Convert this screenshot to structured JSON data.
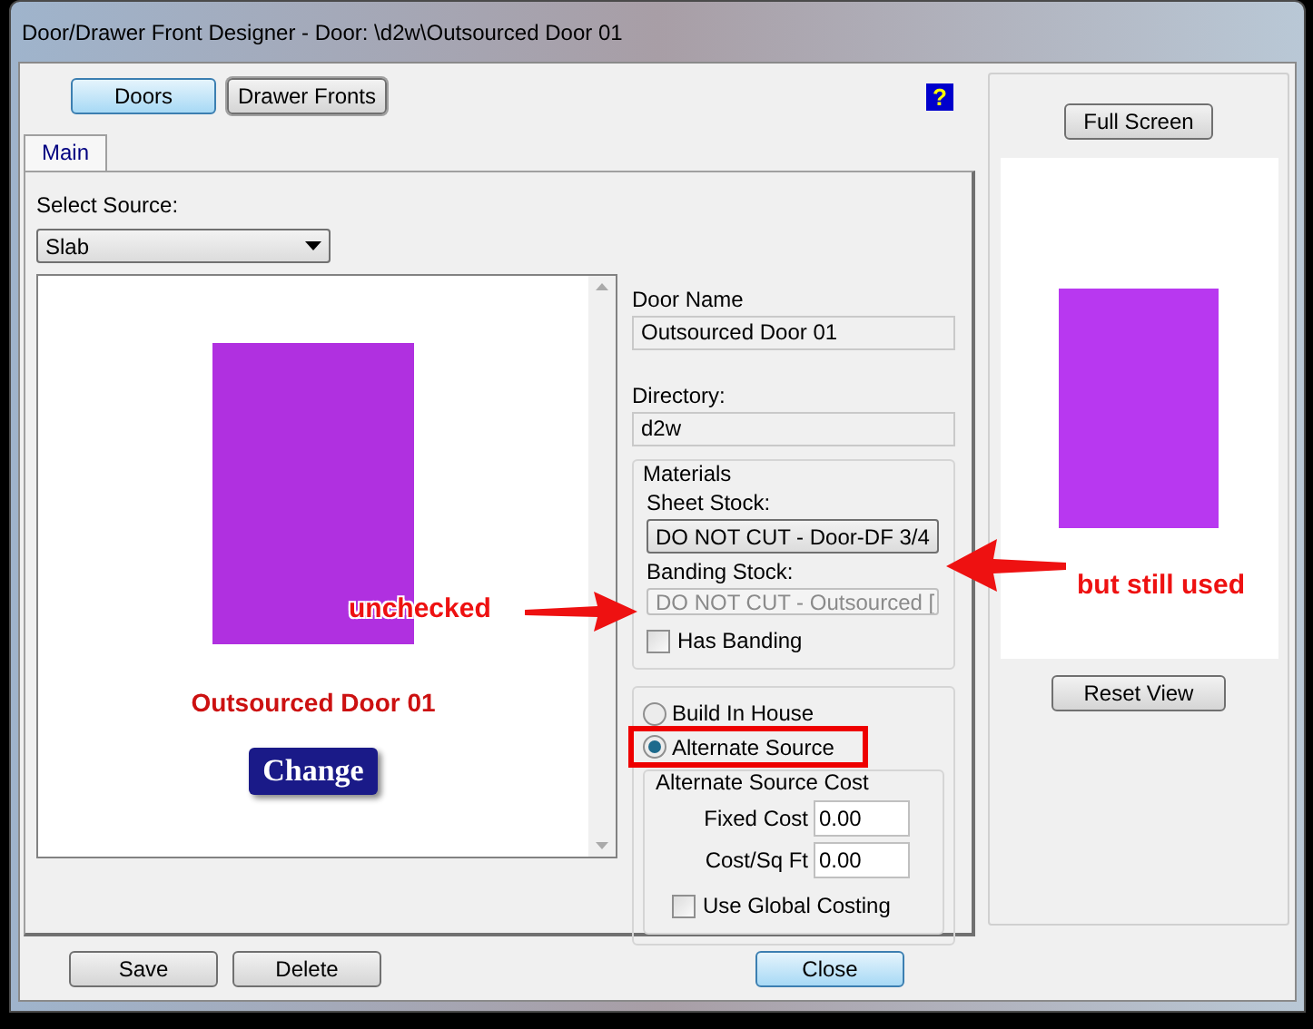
{
  "window": {
    "title": "Door/Drawer Front Designer - Door: \\d2w\\Outsourced Door 01"
  },
  "mode_buttons": [
    {
      "label": "Doors",
      "selected": true
    },
    {
      "label": "Drawer Fronts",
      "selected": false
    }
  ],
  "help_button": "?",
  "tabs": [
    {
      "label": "Main",
      "selected": true
    }
  ],
  "select_source": {
    "label": "Select Source:",
    "value": "Slab"
  },
  "preview": {
    "name": "Outsourced Door 01",
    "button": "Change"
  },
  "door_name": {
    "label": "Door Name",
    "value": "Outsourced Door 01"
  },
  "directory": {
    "label": "Directory:",
    "value": "d2w"
  },
  "materials": {
    "title": "Materials",
    "sheet_stock": {
      "label": "Sheet Stock:",
      "value": "DO NOT CUT - Door-DF 3/4",
      "disabled": false
    },
    "banding_stock": {
      "label": "Banding Stock:",
      "value": "DO NOT CUT - Outsourced [",
      "disabled": true
    },
    "has_banding": {
      "label": "Has Banding",
      "checked": false
    }
  },
  "source_options": [
    {
      "label": "Build In House",
      "selected": false
    },
    {
      "label": "Alternate Source",
      "selected": true
    }
  ],
  "alternate_source_cost": {
    "title": "Alternate Source Cost",
    "fields": [
      {
        "label": "Fixed Cost",
        "value": "0.00"
      },
      {
        "label": "Cost/Sq Ft",
        "value": "0.00"
      }
    ],
    "use_global_costing": {
      "label": "Use Global Costing",
      "checked": false
    }
  },
  "side_panel": {
    "full_screen": "Full Screen",
    "reset_view": "Reset View"
  },
  "footer_buttons": [
    {
      "label": "Save",
      "kind": "normal"
    },
    {
      "label": "Delete",
      "kind": "normal"
    },
    {
      "label": "Close",
      "kind": "default"
    }
  ],
  "annotations": [
    {
      "text": "unchecked"
    },
    {
      "text": "but still used"
    }
  ]
}
